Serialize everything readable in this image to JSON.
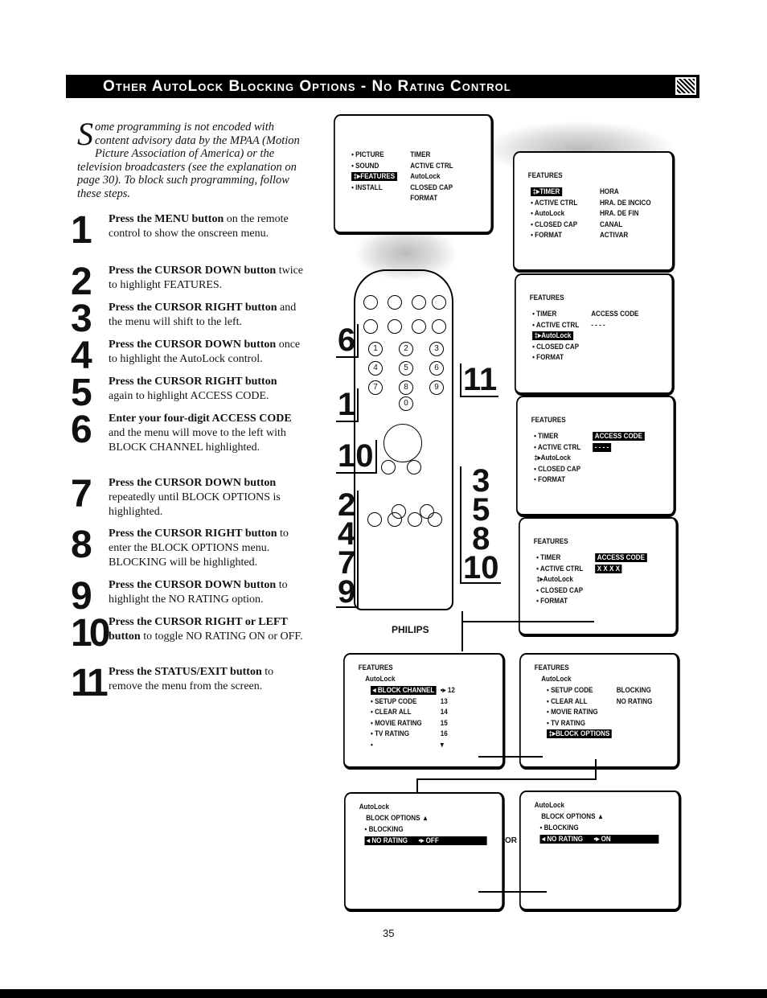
{
  "header": {
    "title": "Other AutoLock Blocking Options - No Rating Control",
    "icon": "menu-screen-icon"
  },
  "intro": {
    "cap": "S",
    "text": "ome programming is not encoded with content advisory data by the MPAA (Motion Picture Association of America) or the television broadcasters (see the explanation on page 30). To block such programming, follow these steps."
  },
  "steps": [
    {
      "num": "1",
      "bold": "Press the MENU button",
      "text": " on the remote control to show the onscreen menu."
    },
    {
      "num": "2",
      "bold": "Press the CURSOR DOWN button",
      "text": " twice to highlight FEATURES."
    },
    {
      "num": "3",
      "bold": "Press the CURSOR RIGHT button",
      "text": " and the menu will shift to the left."
    },
    {
      "num": "4",
      "bold": "Press the CURSOR DOWN button",
      "text": " once to highlight the AutoLock control."
    },
    {
      "num": "5",
      "bold": "Press the CURSOR RIGHT button",
      "text": " again to highlight ACCESS CODE."
    },
    {
      "num": "6",
      "bold": "Enter your four-digit ACCESS CODE",
      "text": " and the menu will move to the left with BLOCK CHANNEL highlighted."
    },
    {
      "num": "7",
      "bold": "Press the CURSOR DOWN button",
      "text": " repeatedly until BLOCK OPTIONS is highlighted."
    },
    {
      "num": "8",
      "bold": "Press the CURSOR RIGHT button",
      "text": " to enter the BLOCK OPTIONS menu. BLOCKING will be highlighted."
    },
    {
      "num": "9",
      "bold": "Press the CURSOR DOWN button",
      "text": " to highlight the NO RATING option."
    },
    {
      "num": "10",
      "bold": "Press the CURSOR RIGHT or LEFT button",
      "text": " to toggle NO RATING ON or OFF."
    },
    {
      "num": "11",
      "bold": "Press the STATUS/EXIT button",
      "text": " to remove the menu from the screen."
    }
  ],
  "screens": [
    {
      "rows": [
        [
          "• PICTURE",
          "TIMER"
        ],
        [
          "• SOUND",
          "ACTIVE CTRL"
        ],
        [
          "‡▸FEATURES*",
          "AutoLock"
        ],
        [
          "• INSTALL",
          "CLOSED CAP"
        ],
        [
          "",
          "FORMAT"
        ]
      ]
    },
    {
      "title": "FEATURES",
      "rows": [
        [
          "‡▸TIMER*",
          "HORA"
        ],
        [
          "• ACTIVE CTRL",
          "HRA. DE INCICO"
        ],
        [
          "• AutoLock",
          "HRA. DE FIN"
        ],
        [
          "• CLOSED CAP",
          "CANAL"
        ],
        [
          "• FORMAT",
          "ACTIVAR"
        ]
      ]
    },
    {
      "title": "FEATURES",
      "rows": [
        [
          "• TIMER",
          "ACCESS CODE"
        ],
        [
          "• ACTIVE CTRL",
          "- - - -"
        ],
        [
          "‡▸AutoLock*",
          ""
        ],
        [
          "• CLOSED CAP",
          ""
        ],
        [
          "• FORMAT",
          ""
        ]
      ]
    },
    {
      "title": "FEATURES",
      "rows": [
        [
          "• TIMER",
          "ACCESS CODE*"
        ],
        [
          "• ACTIVE CTRL",
          "- - - -*"
        ],
        [
          "‡▸AutoLock",
          ""
        ],
        [
          "• CLOSED CAP",
          ""
        ],
        [
          "• FORMAT",
          ""
        ]
      ]
    },
    {
      "title": "FEATURES",
      "rows": [
        [
          "• TIMER",
          "ACCESS CODE*"
        ],
        [
          "• ACTIVE CTRL",
          "X X X X*"
        ],
        [
          "‡▸AutoLock",
          ""
        ],
        [
          "• CLOSED CAP",
          ""
        ],
        [
          "• FORMAT",
          ""
        ]
      ]
    },
    {
      "title": "FEATURES",
      "sub": "AutoLock",
      "rows": [
        [
          "◂ BLOCK CHANNEL*",
          "•▸ 12"
        ],
        [
          "• SETUP CODE",
          "13"
        ],
        [
          "• CLEAR ALL",
          "14"
        ],
        [
          "• MOVIE RATING",
          "15"
        ],
        [
          "• TV RATING",
          "16"
        ],
        [
          "•",
          "▾"
        ]
      ]
    },
    {
      "title": "FEATURES",
      "sub": "AutoLock",
      "rows": [
        [
          "• SETUP CODE",
          "BLOCKING"
        ],
        [
          "• CLEAR ALL",
          "NO RATING"
        ],
        [
          "• MOVIE RATING",
          ""
        ],
        [
          "• TV RATING",
          ""
        ],
        [
          "‡▸BLOCK OPTIONS*",
          ""
        ]
      ]
    },
    {
      "title": "AutoLock",
      "sub": "BLOCK OPTIONS  ▴",
      "rows": [
        [
          "• BLOCKING",
          ""
        ],
        [
          "◂ NO RATING      •▸ OFF*",
          ""
        ]
      ]
    },
    {
      "title": "AutoLock",
      "sub": "BLOCK OPTIONS  ▴",
      "rows": [
        [
          "• BLOCKING",
          ""
        ],
        [
          "◂ NO RATING      •▸ ON*",
          ""
        ]
      ]
    }
  ],
  "or_label": "OR",
  "remote": {
    "brand": "PHILIPS",
    "keys": [
      "1",
      "2",
      "3",
      "4",
      "5",
      "6",
      "7",
      "8",
      "9",
      "0"
    ]
  },
  "callouts": {
    "a": "6",
    "b": "11",
    "c": "1",
    "d": "10",
    "right": "3\n5\n8\n10",
    "left": "2\n4\n7\n9"
  },
  "page_number": "35"
}
